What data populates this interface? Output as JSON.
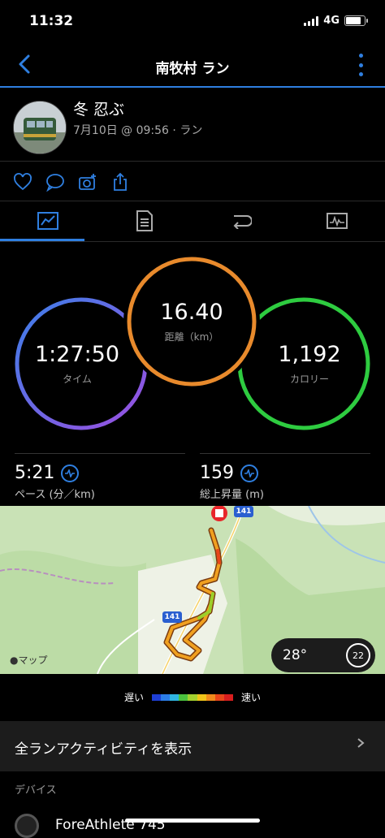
{
  "status_bar": {
    "time": "11:32",
    "network": "4G"
  },
  "header": {
    "title": "南牧村 ラン"
  },
  "activity": {
    "user_name": "冬 忍ぶ",
    "subtitle": "7月10日 @ 09:56 · ラン"
  },
  "action_icons": [
    "heart-icon",
    "comment-icon",
    "camera-icon",
    "share-icon"
  ],
  "tabs": [
    "summary-icon",
    "details-icon",
    "laps-icon",
    "chart-icon"
  ],
  "metrics": {
    "time": {
      "value": "1:27:50",
      "label": "タイム"
    },
    "distance": {
      "value": "16.40",
      "label": "距離（km）"
    },
    "calories": {
      "value": "1,192",
      "label": "カロリー"
    }
  },
  "stats": {
    "pace": {
      "value": "5:21",
      "label": "ペース (分／km)"
    },
    "ascent": {
      "value": "159",
      "label": "総上昇量 (m)"
    }
  },
  "map": {
    "label": "マップ",
    "route_label_1": "141",
    "route_label_2": "141",
    "temperature": "28°",
    "wind": "22"
  },
  "legend": {
    "slow": "遅い",
    "fast": "速い",
    "colors": [
      "#1e3fd6",
      "#2b7de8",
      "#2fb5e0",
      "#4bc23e",
      "#a4d12f",
      "#f0c419",
      "#f08a1c",
      "#e8461a",
      "#d81e1e"
    ]
  },
  "list": {
    "show_all": "全ランアクティビティを表示",
    "device_section": "デバイス",
    "device_name": "ForeAthlete 745"
  },
  "colors": {
    "accent": "#2f7fe0",
    "time_ring": "#6a5cf0",
    "distance_ring": "#e88a2c",
    "calories_ring": "#2ecc40"
  }
}
